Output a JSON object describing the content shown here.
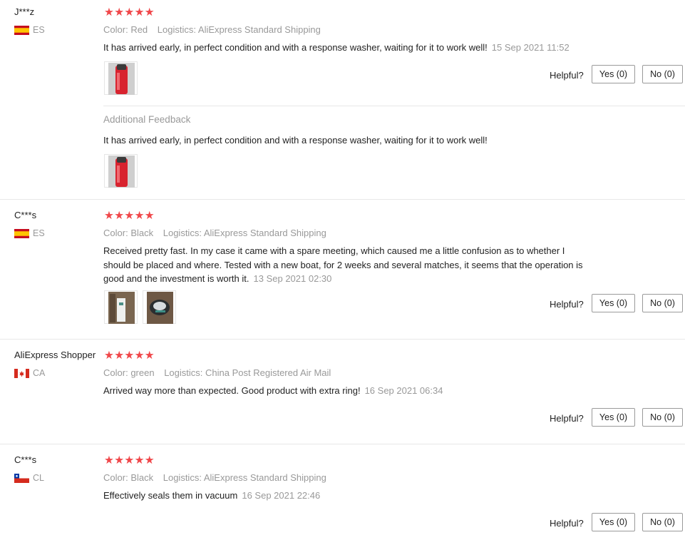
{
  "colors": {
    "star": "#f0474a",
    "muted": "#999999",
    "border": "#9a9a9a"
  },
  "reviews": [
    {
      "user": "J***z",
      "country": "ES",
      "flag": "spain",
      "stars": "★★★★★",
      "color_label": "Color:",
      "color_value": "Red",
      "logistics_label": "Logistics:",
      "logistics_value": "AliExpress Standard Shipping",
      "text": "It has arrived early, in perfect condition and with a response washer, waiting for it to work well!",
      "date": "15 Sep 2021 11:52",
      "helpful": "Helpful?",
      "yes": "Yes (0)",
      "no": "No (0)",
      "additional_title": "Additional Feedback",
      "additional_text": "It has arrived early, in perfect condition and with a response washer, waiting for it to work well!"
    },
    {
      "user": "C***s",
      "country": "ES",
      "flag": "spain",
      "stars": "★★★★★",
      "color_label": "Color:",
      "color_value": "Black",
      "logistics_label": "Logistics:",
      "logistics_value": "AliExpress Standard Shipping",
      "text_lines": [
        "Received pretty fast. In my case it came with a spare meeting, which caused me a little confusion as to whether I",
        "should be placed and where. Tested with a new boat, for 2 weeks and several matches, it seems that the operation is",
        "good and the investment is worth it."
      ],
      "date": "13 Sep 2021 02:30",
      "helpful": "Helpful?",
      "yes": "Yes (0)",
      "no": "No (0)"
    },
    {
      "user": "AliExpress Shopper",
      "country": "CA",
      "flag": "canada",
      "stars": "★★★★★",
      "color_label": "Color:",
      "color_value": "green",
      "logistics_label": "Logistics:",
      "logistics_value": "China Post Registered Air Mail",
      "text": "Arrived way more than expected. Good product with extra ring!",
      "date": "16 Sep 2021 06:34",
      "helpful": "Helpful?",
      "yes": "Yes (0)",
      "no": "No (0)"
    },
    {
      "user": "C***s",
      "country": "CL",
      "flag": "chile",
      "stars": "★★★★★",
      "color_label": "Color:",
      "color_value": "Black",
      "logistics_label": "Logistics:",
      "logistics_value": "AliExpress Standard Shipping",
      "text": "Effectively seals them in vacuum",
      "date": "16 Sep 2021 22:46",
      "helpful": "Helpful?",
      "yes": "Yes (0)",
      "no": "No (0)"
    }
  ]
}
